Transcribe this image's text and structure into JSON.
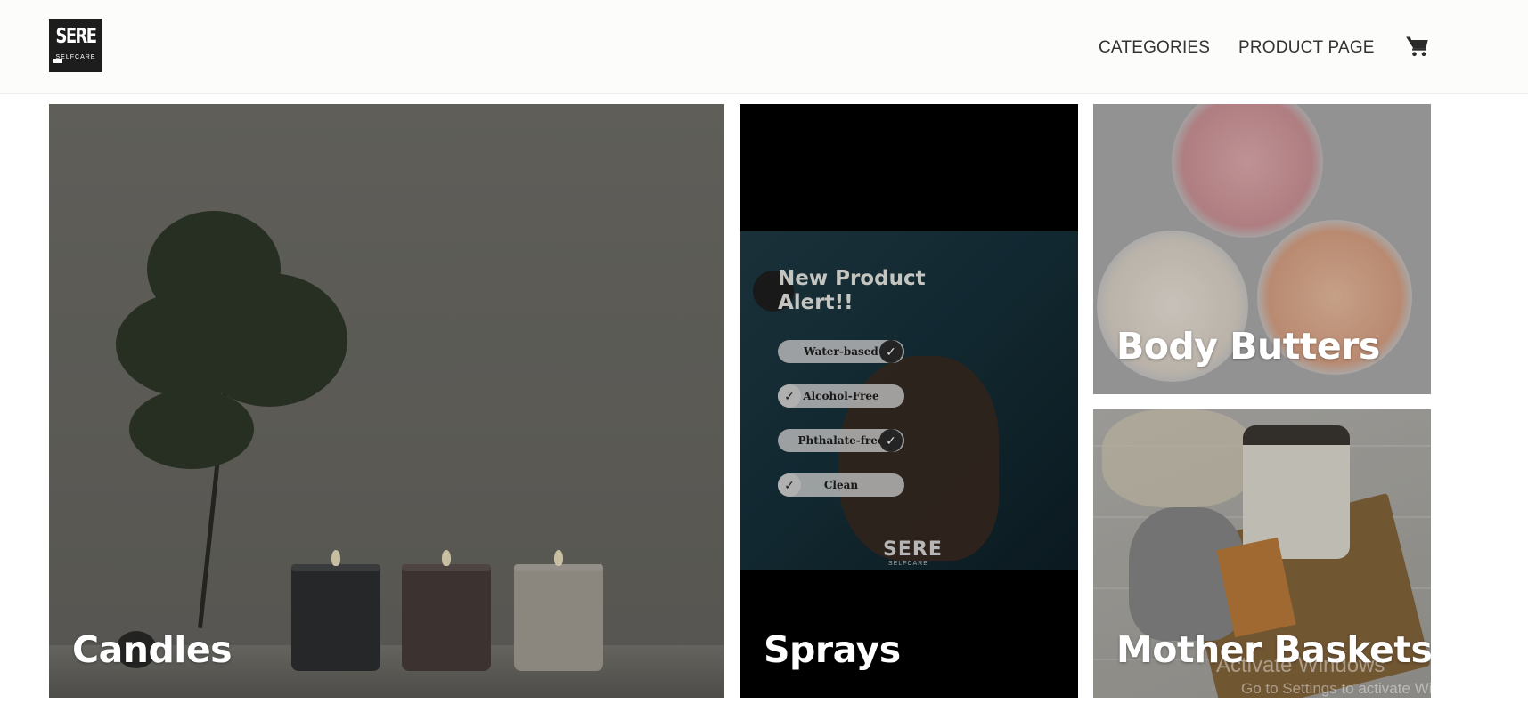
{
  "header": {
    "logo_text": "SERE",
    "logo_subtext": "SELFCARE",
    "nav": [
      {
        "label": "CATEGORIES"
      },
      {
        "label": "PRODUCT PAGE"
      }
    ],
    "cart_icon": "shopping-cart-icon"
  },
  "tiles": [
    {
      "label": "Candles"
    },
    {
      "label": "Sprays",
      "poster": {
        "title_line1": "New Product",
        "title_line2": "Alert!!",
        "features": [
          "Water-based",
          "Alcohol-Free",
          "Phthalate-free",
          "Clean"
        ],
        "brand": "SERE",
        "brand_sub": "SELFCARE"
      }
    },
    {
      "label": "Body Butters"
    },
    {
      "label": "Mother Baskets"
    }
  ],
  "watermark": {
    "title": "Activate Windows",
    "subtitle": "Go to Settings to activate Windows."
  },
  "colors": {
    "overlay": "rgba(0,0,0,0.35)",
    "tile_text": "#ffffff",
    "nav_text": "#333333",
    "header_bg": "#fcfcfb"
  }
}
